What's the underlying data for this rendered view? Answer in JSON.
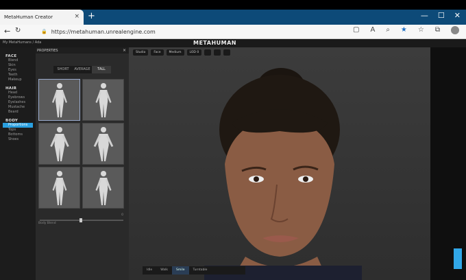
{
  "browser": {
    "tab_title": "MetaHuman Creator",
    "tab_close": "×",
    "new_tab": "+",
    "window_controls": [
      "—",
      "☐",
      "✕"
    ],
    "url": "https://metahuman.unrealengine.com"
  },
  "app": {
    "brand": "METAHUMAN",
    "project": "My MetaHumans / Ada",
    "panel_title": "PROPERTIES",
    "panel_close": "×",
    "height_tabs": [
      "SHORT",
      "AVERAGE",
      "TALL"
    ],
    "active_height": "TALL",
    "slider_label": "Body Blend",
    "slider_value": "0",
    "nav": [
      {
        "section": "FACE",
        "items": [
          "Blend",
          "Skin",
          "Eyes",
          "Teeth",
          "Makeup"
        ]
      },
      {
        "section": "HAIR",
        "items": [
          "Head",
          "Eyebrows",
          "Eyelashes",
          "Mustache",
          "Beard"
        ]
      },
      {
        "section": "BODY",
        "items": [
          "Proportions",
          "Tops",
          "Bottoms",
          "Shoes"
        ]
      }
    ],
    "active_nav": "Proportions",
    "viewport_tools": [
      "Studio",
      "Face",
      "Medium",
      "LOD 0"
    ],
    "bottom_modes": [
      "Idle",
      "Walk",
      "Smile",
      "Turntable"
    ],
    "active_mode": "Smile"
  },
  "colors": {
    "accent": "#2aa0e0",
    "tab_bar": "#0d4a78",
    "viewport_bg": "#343434"
  }
}
